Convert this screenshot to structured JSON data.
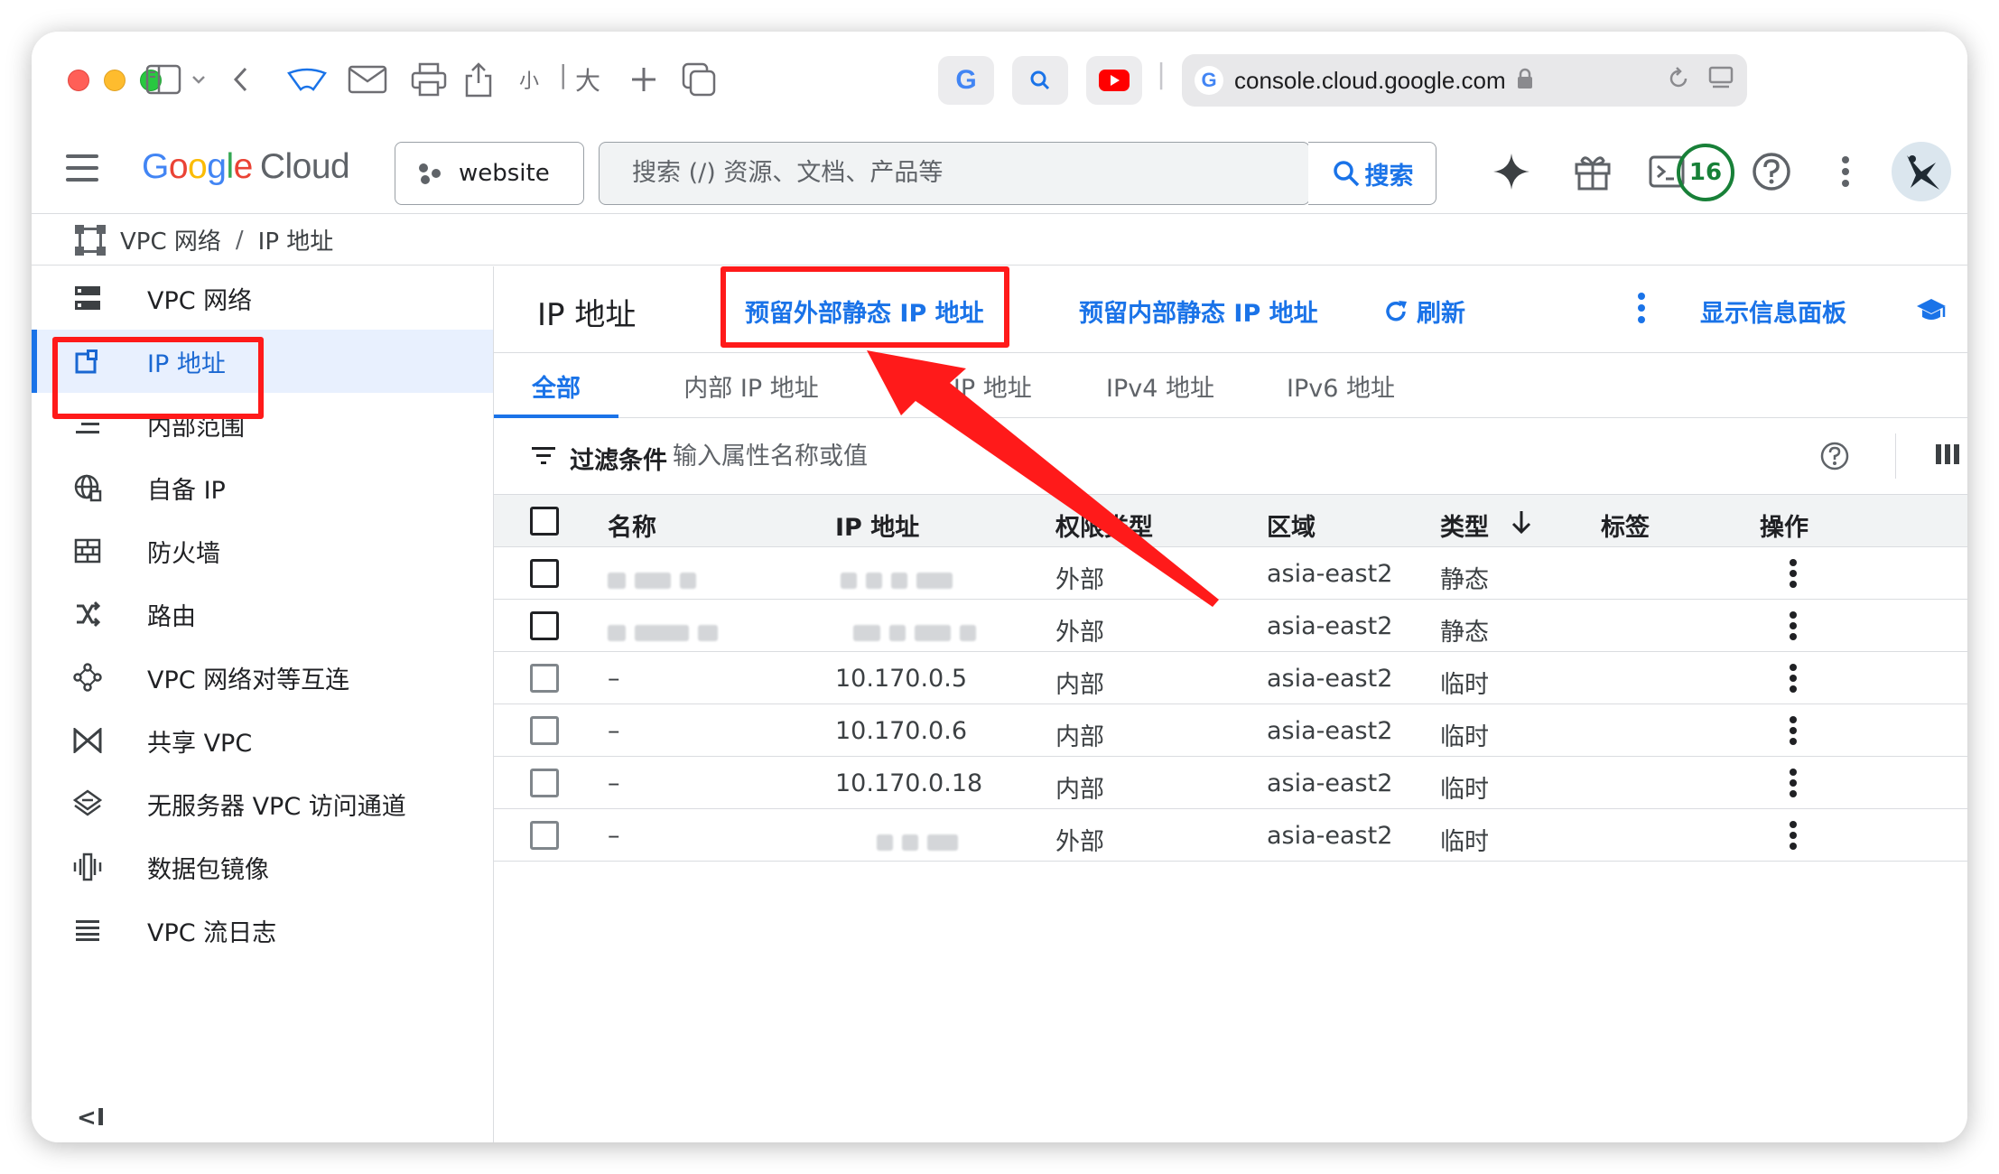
{
  "browser": {
    "url": "console.cloud.google.com",
    "zoom_small": "小",
    "zoom_large": "大"
  },
  "header": {
    "logo": [
      "G",
      "o",
      "o",
      "g",
      "l",
      "e"
    ],
    "logo_cloud": "Cloud",
    "project": "website",
    "search_placeholder": "搜索 (/) 资源、文档、产品等",
    "search_button": "搜索",
    "notifications_count": "16"
  },
  "breadcrumb": {
    "parent": "VPC 网络",
    "separator": "/",
    "current": "IP 地址"
  },
  "sidebar": {
    "items": [
      {
        "label": "VPC 网络",
        "icon": "vpc-network-icon"
      },
      {
        "label": "IP 地址",
        "icon": "ip-address-icon",
        "active": true
      },
      {
        "label": "内部范围",
        "icon": "internal-ranges-icon"
      },
      {
        "label": "自备 IP",
        "icon": "byoip-icon"
      },
      {
        "label": "防火墙",
        "icon": "firewall-icon"
      },
      {
        "label": "路由",
        "icon": "routes-icon"
      },
      {
        "label": "VPC 网络对等互连",
        "icon": "peering-icon"
      },
      {
        "label": "共享 VPC",
        "icon": "shared-vpc-icon"
      },
      {
        "label": "无服务器 VPC 访问通道",
        "icon": "serverless-vpc-icon"
      },
      {
        "label": "数据包镜像",
        "icon": "packet-mirroring-icon"
      },
      {
        "label": "VPC 流日志",
        "icon": "flow-logs-icon"
      }
    ],
    "collapse_label": "<I"
  },
  "main": {
    "title": "IP 地址",
    "actions": {
      "reserve_external": "预留外部静态 IP 地址",
      "reserve_internal": "预留内部静态 IP 地址",
      "refresh": "刷新",
      "show_info_panel": "显示信息面板"
    },
    "tabs": [
      {
        "label": "全部",
        "active": true
      },
      {
        "label": "内部 IP 地址"
      },
      {
        "label": "外部 IP 地址"
      },
      {
        "label": "IPv4 地址"
      },
      {
        "label": "IPv6 地址"
      }
    ],
    "filter": {
      "label": "过滤条件",
      "placeholder": "输入属性名称或值"
    },
    "table": {
      "headers": [
        "名称",
        "IP 地址",
        "权限类型",
        "区域",
        "类型",
        "标签",
        "操作"
      ],
      "rows": [
        {
          "name": "",
          "ip": "",
          "access": "外部",
          "region": "asia-east2",
          "type": "静态",
          "redacted": true,
          "selectable": true
        },
        {
          "name": "",
          "ip": "",
          "access": "外部",
          "region": "asia-east2",
          "type": "静态",
          "redacted": true,
          "selectable": true
        },
        {
          "name": "–",
          "ip": "10.170.0.5",
          "access": "内部",
          "region": "asia-east2",
          "type": "临时",
          "selectable": false
        },
        {
          "name": "–",
          "ip": "10.170.0.6",
          "access": "内部",
          "region": "asia-east2",
          "type": "临时",
          "selectable": false
        },
        {
          "name": "–",
          "ip": "10.170.0.18",
          "access": "内部",
          "region": "asia-east2",
          "type": "临时",
          "selectable": false
        },
        {
          "name": "–",
          "ip": "",
          "access": "外部",
          "region": "asia-east2",
          "type": "临时",
          "redacted_ip": true,
          "selectable": false
        }
      ]
    }
  },
  "colors": {
    "accent": "#1a73e8",
    "highlight": "#ff1a1a",
    "active_bg": "#e8f0fe"
  }
}
